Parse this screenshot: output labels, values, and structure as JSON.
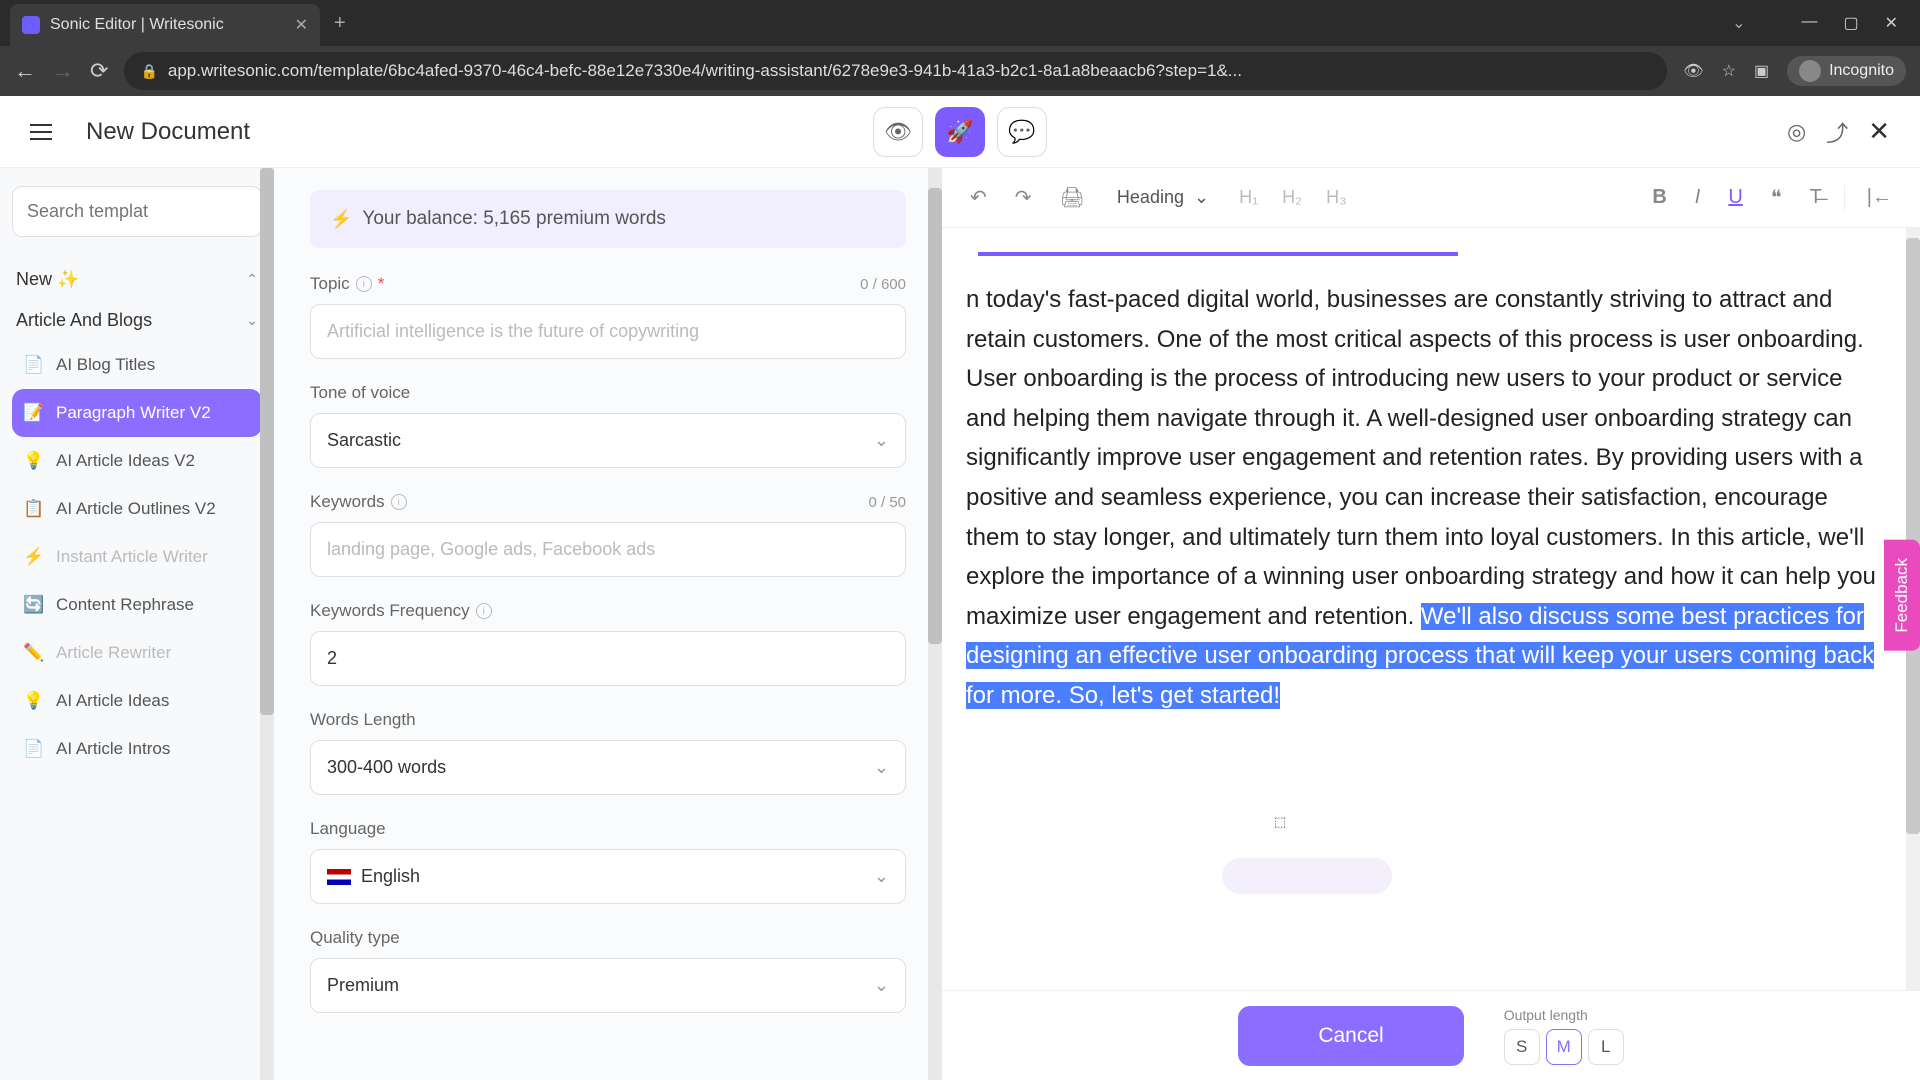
{
  "browser": {
    "tab_title": "Sonic Editor | Writesonic",
    "url": "app.writesonic.com/template/6bc4afed-9370-46c4-befc-88e12e7330e4/writing-assistant/6278e9e3-941b-41a3-b2c1-8a1a8beaacb6?step=1&...",
    "incognito": "Incognito"
  },
  "header": {
    "doc_title": "New Document"
  },
  "sidebar": {
    "search_placeholder": "Search templat",
    "groups": {
      "new": "New ✨",
      "articles": "Article And Blogs"
    },
    "items": {
      "blog_titles": "AI Blog Titles",
      "paragraph_writer": "Paragraph Writer V2",
      "article_ideas": "AI Article Ideas V2",
      "article_outlines": "AI Article Outlines V2",
      "instant_writer": "Instant Article Writer",
      "content_rephrase": "Content Rephrase",
      "article_rewriter": "Article Rewriter",
      "article_ideas2": "AI Article Ideas",
      "article_intros": "AI Article Intros"
    }
  },
  "form": {
    "balance": "Your balance: 5,165 premium words",
    "topic": {
      "label": "Topic",
      "placeholder": "Artificial intelligence is the future of copywriting",
      "counter": "0 / 600"
    },
    "tone": {
      "label": "Tone of voice",
      "value": "Sarcastic"
    },
    "keywords": {
      "label": "Keywords",
      "placeholder": "landing page, Google ads, Facebook ads",
      "counter": "0 / 50"
    },
    "kw_freq": {
      "label": "Keywords Frequency",
      "value": "2"
    },
    "words_length": {
      "label": "Words Length",
      "value": "300-400 words"
    },
    "language": {
      "label": "Language",
      "value": "English"
    },
    "quality": {
      "label": "Quality type",
      "value": "Premium"
    }
  },
  "editor": {
    "heading_select": "Heading",
    "h1": "H₁",
    "h2": "H₂",
    "h3": "H₃",
    "text_normal": "n today's fast-paced digital world, businesses are constantly striving to attract and retain customers. One of the most critical aspects of this process is user onboarding. User onboarding is the process of introducing new users to your product or service and helping them navigate through it. A well-designed user onboarding strategy can significantly improve user engagement and retention rates. By providing users with a positive and seamless experience, you can increase their satisfaction, encourage them to stay longer, and ultimately turn them into loyal customers. In this article, we'll explore the importance of a winning user onboarding strategy and how it can help you maximize user engagement and retention. ",
    "text_highlight": "We'll also discuss some best practices for designing an effective user onboarding process that will keep your users coming back for more. So, let's get started!"
  },
  "bottom": {
    "cancel": "Cancel",
    "output_label": "Output length",
    "s": "S",
    "m": "M",
    "l": "L"
  },
  "feedback": "Feedback"
}
